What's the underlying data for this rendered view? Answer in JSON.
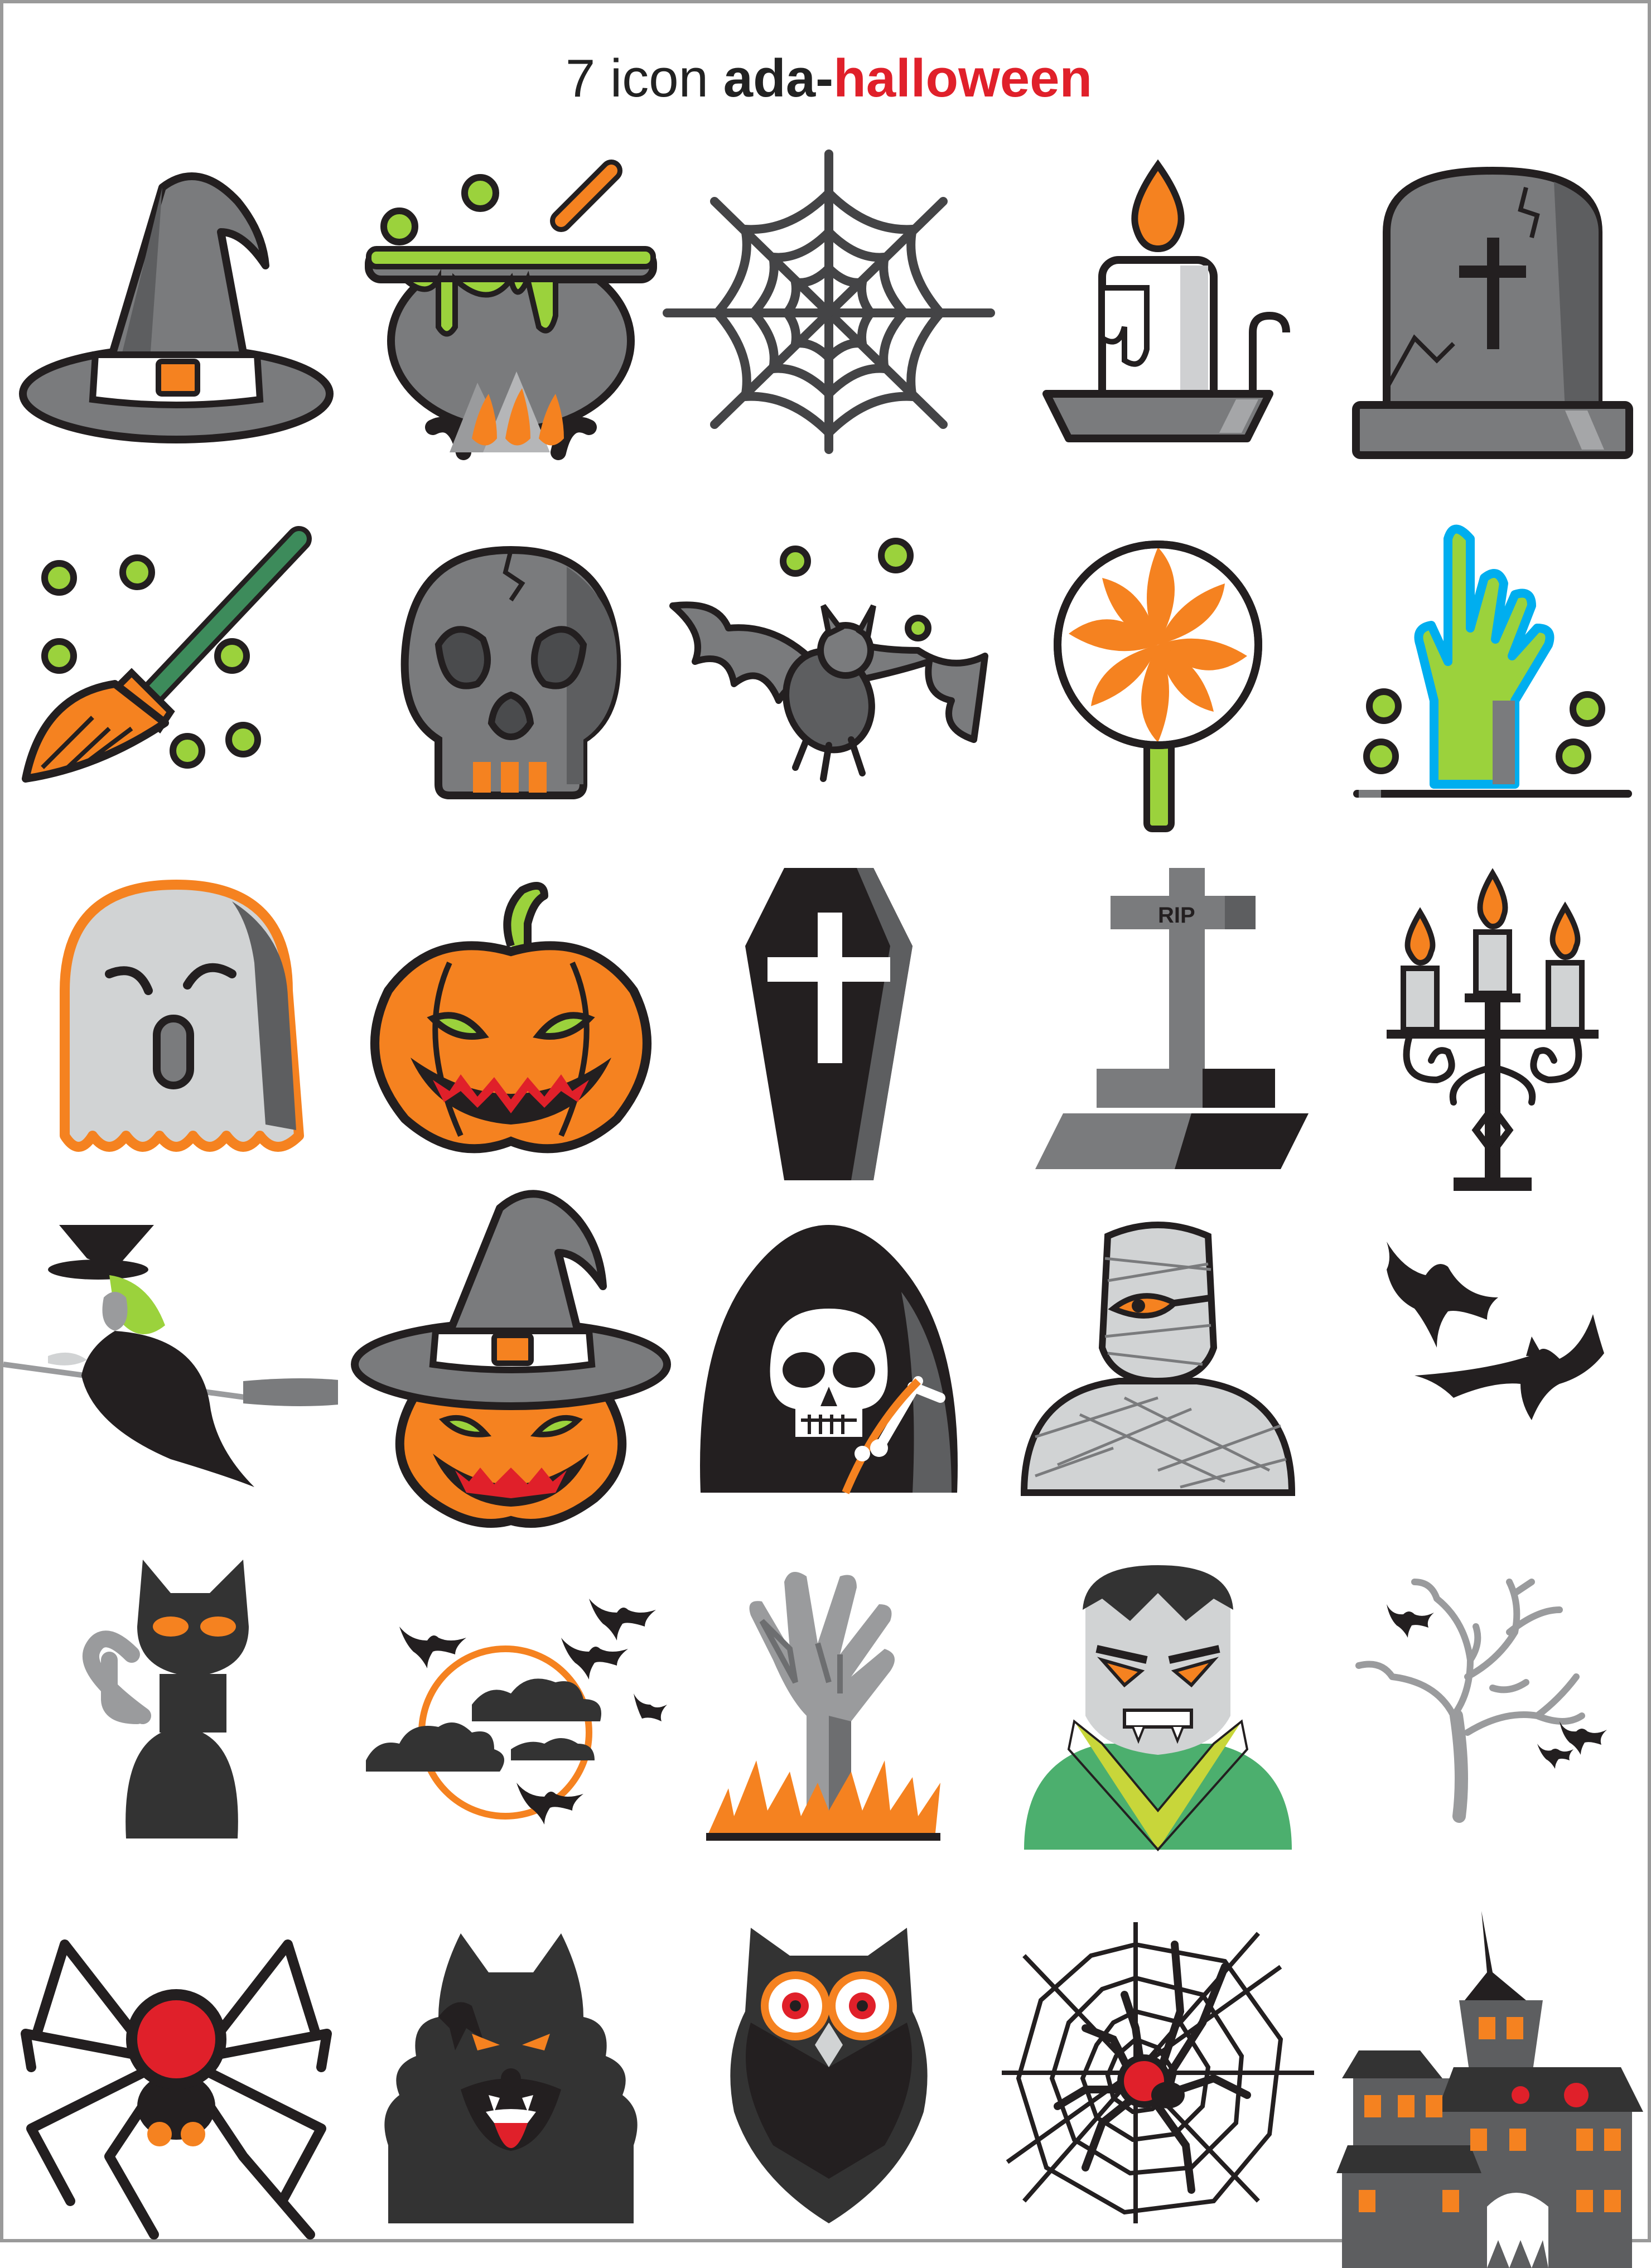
{
  "title": {
    "count": "7 icon ",
    "brand": "ada-",
    "theme": "halloween"
  },
  "colors": {
    "accent": "#f58220",
    "title_red": "#e0202a",
    "slime": "#9bd23c",
    "gray": "#7a7b7d",
    "dark": "#333333",
    "outline": "#231f20"
  },
  "icons": [
    {
      "name": "witch-hat-icon"
    },
    {
      "name": "cauldron-icon"
    },
    {
      "name": "spider-web-icon"
    },
    {
      "name": "candle-holder-icon"
    },
    {
      "name": "tombstone-cross-icon"
    },
    {
      "name": "broom-icon"
    },
    {
      "name": "skull-icon"
    },
    {
      "name": "bat-icon"
    },
    {
      "name": "lollipop-icon"
    },
    {
      "name": "zombie-hand-icon"
    },
    {
      "name": "ghost-icon"
    },
    {
      "name": "jack-o-lantern-icon"
    },
    {
      "name": "coffin-icon"
    },
    {
      "name": "rip-cross-icon",
      "label": "RIP"
    },
    {
      "name": "candelabra-icon"
    },
    {
      "name": "flying-witch-icon"
    },
    {
      "name": "pumpkin-witch-hat-icon"
    },
    {
      "name": "grim-reaper-icon"
    },
    {
      "name": "mummy-icon"
    },
    {
      "name": "two-bats-icon"
    },
    {
      "name": "black-cat-icon"
    },
    {
      "name": "bats-moon-clouds-icon"
    },
    {
      "name": "zombie-hand-fire-icon"
    },
    {
      "name": "vampire-icon"
    },
    {
      "name": "dead-tree-bats-icon"
    },
    {
      "name": "spider-icon"
    },
    {
      "name": "werewolf-icon"
    },
    {
      "name": "owl-icon"
    },
    {
      "name": "spider-on-web-icon"
    },
    {
      "name": "haunted-house-icon"
    }
  ]
}
